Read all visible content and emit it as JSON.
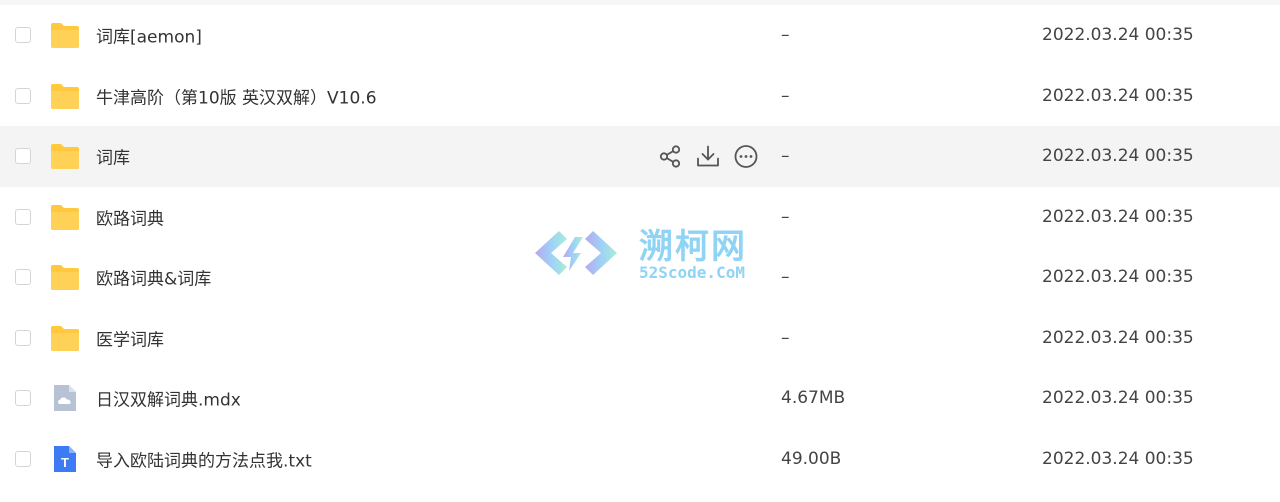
{
  "rows": [
    {
      "name": "词库[aemon]",
      "size": "–",
      "date": "2022.03.24 00:35",
      "type": "folder"
    },
    {
      "name": "牛津高阶（第10版 英汉双解）V10.6",
      "size": "–",
      "date": "2022.03.24 00:35",
      "type": "folder"
    },
    {
      "name": "词库",
      "size": "–",
      "date": "2022.03.24 00:35",
      "type": "folder"
    },
    {
      "name": "欧路词典",
      "size": "–",
      "date": "2022.03.24 00:35",
      "type": "folder"
    },
    {
      "name": "欧路词典&词库",
      "size": "–",
      "date": "2022.03.24 00:35",
      "type": "folder"
    },
    {
      "name": "医学词库",
      "size": "–",
      "date": "2022.03.24 00:35",
      "type": "folder"
    },
    {
      "name": "日汉双解词典.mdx",
      "size": "4.67MB",
      "date": "2022.03.24 00:35",
      "type": "file-cloud"
    },
    {
      "name": "导入欧陆词典的方法点我.txt",
      "size": "49.00B",
      "date": "2022.03.24 00:35",
      "type": "file-text"
    }
  ],
  "hovered_row_index": 2,
  "row_actions": {
    "share_icon": "share-icon",
    "download_icon": "download-icon",
    "more_icon": "more-icon"
  },
  "text_file_icon_glyph": "T",
  "watermark": {
    "title": "溯柯网",
    "subtitle": "52Scode.CoM"
  },
  "colors": {
    "folder": "#ffc83d",
    "hover_background": "#f4f4f5",
    "text_file_icon": "#3d7bf5",
    "cloud_file_icon": "#b7c3d4",
    "watermark": "#8fd3f5"
  }
}
